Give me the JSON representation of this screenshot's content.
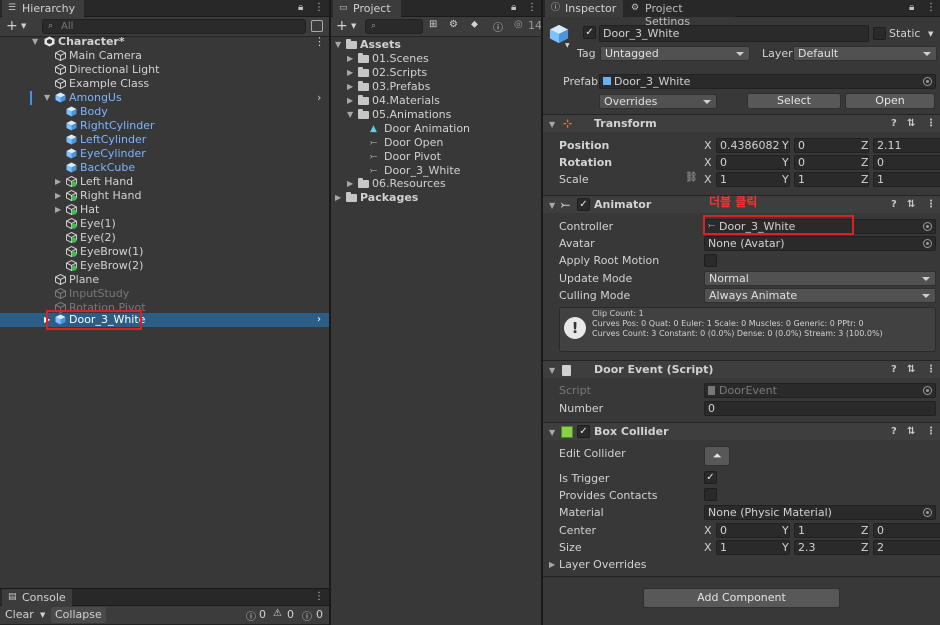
{
  "hierarchy": {
    "tab": "Hierarchy",
    "search_placeholder": "All",
    "root": "Character*",
    "items": [
      {
        "label": "Main Camera"
      },
      {
        "label": "Directional Light"
      },
      {
        "label": "Example Class"
      },
      {
        "label": "AmongUs"
      },
      {
        "label": "Body"
      },
      {
        "label": "RightCylinder"
      },
      {
        "label": "LeftCylinder"
      },
      {
        "label": "EyeCylinder"
      },
      {
        "label": "BackCube"
      },
      {
        "label": "Left Hand"
      },
      {
        "label": "Right Hand"
      },
      {
        "label": "Hat"
      },
      {
        "label": "Eye(1)"
      },
      {
        "label": "Eye(2)"
      },
      {
        "label": "EyeBrow(1)"
      },
      {
        "label": "EyeBrow(2)"
      },
      {
        "label": "Plane"
      },
      {
        "label": "InputStudy"
      },
      {
        "label": "Rotation Pivot"
      },
      {
        "label": "Door_3_White"
      }
    ]
  },
  "console": {
    "tab": "Console",
    "clear": "Clear",
    "collapse": "Collapse",
    "info_count": "0",
    "warn_count": "0",
    "error_count": "0"
  },
  "project": {
    "tab": "Project",
    "hidden_count": "14",
    "assets": "Assets",
    "folders": [
      {
        "label": "01.Scenes"
      },
      {
        "label": "02.Scripts"
      },
      {
        "label": "03.Prefabs"
      },
      {
        "label": "04.Materials"
      },
      {
        "label": "05.Animations"
      }
    ],
    "anim_items": [
      {
        "label": "Door Animation"
      },
      {
        "label": "Door Open"
      },
      {
        "label": "Door Pivot"
      },
      {
        "label": "Door_3_White"
      }
    ],
    "resources": "06.Resources",
    "packages": "Packages"
  },
  "inspector": {
    "tab": "Inspector",
    "tab2": "Project Settings",
    "object_name": "Door_3_White",
    "static_label": "Static",
    "tag_label": "Tag",
    "tag_value": "Untagged",
    "layer_label": "Layer",
    "layer_value": "Default",
    "prefab_label": "Prefab",
    "prefab_value": "Door_3_White",
    "overrides": "Overrides",
    "select": "Select",
    "open": "Open",
    "transform": {
      "title": "Transform",
      "position_label": "Position",
      "rotation_label": "Rotation",
      "scale_label": "Scale",
      "pos": [
        "0.4386082",
        "0",
        "2.11"
      ],
      "rot": [
        "0",
        "0",
        "0"
      ],
      "scale": [
        "1",
        "1",
        "1"
      ]
    },
    "animator": {
      "title": "Animator",
      "annotation": "더블 클릭",
      "controller_label": "Controller",
      "controller_value": "Door_3_White",
      "avatar_label": "Avatar",
      "avatar_value": "None (Avatar)",
      "apply_root_label": "Apply Root Motion",
      "update_mode_label": "Update Mode",
      "update_mode_value": "Normal",
      "culling_mode_label": "Culling Mode",
      "culling_mode_value": "Always Animate",
      "info_line1": "Clip Count: 1",
      "info_line2": "Curves Pos: 0 Quat: 0 Euler: 1 Scale: 0 Muscles: 0 Generic: 0 PPtr: 0",
      "info_line3": "Curves Count: 3 Constant: 0 (0.0%) Dense: 0 (0.0%) Stream: 3 (100.0%)"
    },
    "door_event": {
      "title": "Door Event (Script)",
      "script_label": "Script",
      "script_value": "DoorEvent",
      "number_label": "Number",
      "number_value": "0"
    },
    "box_collider": {
      "title": "Box Collider",
      "edit_label": "Edit Collider",
      "trigger_label": "Is Trigger",
      "contacts_label": "Provides Contacts",
      "material_label": "Material",
      "material_value": "None (Physic Material)",
      "center_label": "Center",
      "size_label": "Size",
      "center": [
        "0",
        "1",
        "0"
      ],
      "size": [
        "1",
        "2.3",
        "2"
      ],
      "layer_overrides": "Layer Overrides"
    },
    "add_component": "Add Component"
  },
  "axes": {
    "x": "X",
    "y": "Y",
    "z": "Z"
  },
  "colors": {
    "selection": "#2c5d87",
    "annotation": "#e02020",
    "prefab_blue": "#7cb4ff"
  }
}
